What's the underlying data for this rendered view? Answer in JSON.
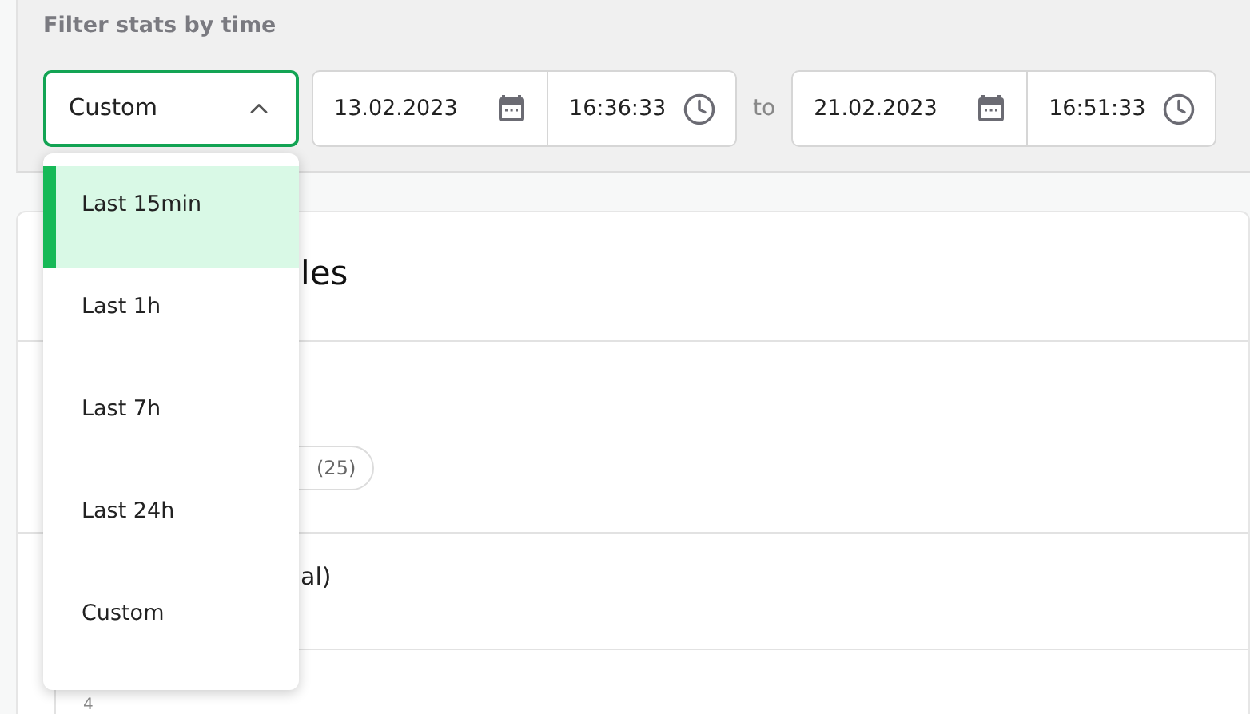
{
  "filter": {
    "title": "Filter stats by time",
    "select": {
      "value": "Custom",
      "expanded": true,
      "options": [
        {
          "label": "Last 15min",
          "highlighted": true
        },
        {
          "label": "Last 1h",
          "highlighted": false
        },
        {
          "label": "Last 7h",
          "highlighted": false
        },
        {
          "label": "Last 24h",
          "highlighted": false
        },
        {
          "label": "Custom",
          "highlighted": false
        }
      ]
    },
    "from": {
      "date": "13.02.2023",
      "time": "16:36:33"
    },
    "separator": "to",
    "to": {
      "date": "21.02.2023",
      "time": "16:51:33"
    }
  },
  "card": {
    "heading": "les",
    "rows": [
      {
        "kind": "chip",
        "text": "(25)"
      },
      {
        "kind": "text",
        "text": "al)"
      },
      {
        "kind": "nested",
        "text": "4"
      }
    ]
  }
}
